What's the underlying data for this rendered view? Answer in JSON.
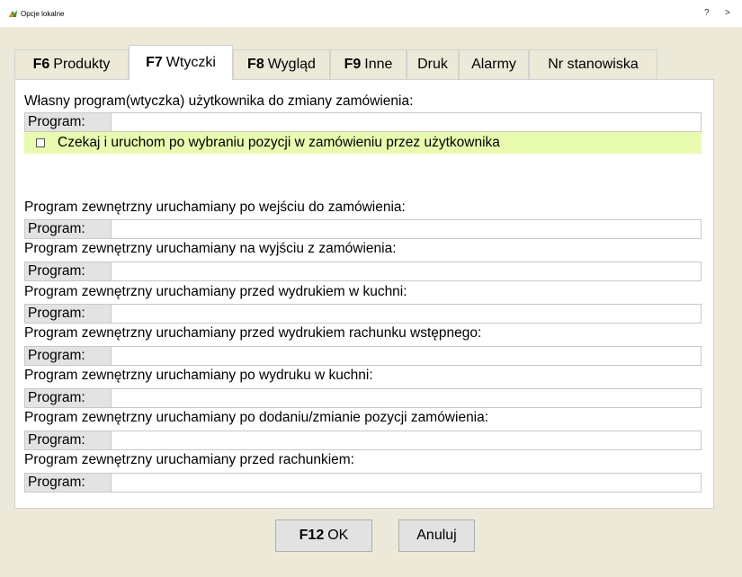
{
  "window": {
    "title": "Opcje lokalne",
    "help": "?",
    "close": ">"
  },
  "tabs": [
    {
      "key": "F6",
      "label": "Produkty"
    },
    {
      "key": "F7",
      "label": "Wtyczki"
    },
    {
      "key": "F8",
      "label": "Wygląd"
    },
    {
      "key": "F9",
      "label": "Inne"
    },
    {
      "key": "",
      "label": "Druk"
    },
    {
      "key": "",
      "label": "Alarmy"
    },
    {
      "key": "",
      "label": "Nr stanowiska"
    }
  ],
  "main": {
    "user_plugin_heading": "Własny program(wtyczka) użytkownika do zmiany zamówienia:",
    "program_label": "Program:",
    "wait_checkbox_label": "Czekaj i uruchom po wybraniu pozycji w zamówieniu przez użytkownika",
    "wait_checkbox_checked": false,
    "sections": [
      {
        "label": "Program zewnętrzny uruchamiany po wejściu do zamówienia:",
        "value": ""
      },
      {
        "label": "Program zewnętrzny uruchamiany na wyjściu z zamówienia:",
        "value": ""
      },
      {
        "label": "Program zewnętrzny uruchamiany przed wydrukiem w kuchni:",
        "value": ""
      },
      {
        "label": "Program zewnętrzny uruchamiany przed wydrukiem rachunku wstępnego:",
        "value": ""
      },
      {
        "label": "Program zewnętrzny uruchamiany po wydruku w kuchni:",
        "value": ""
      },
      {
        "label": "Program zewnętrzny uruchamiany po dodaniu/zmianie pozycji zamówienia:",
        "value": ""
      },
      {
        "label": "Program zewnętrzny uruchamiany przed rachunkiem:",
        "value": ""
      }
    ]
  },
  "buttons": {
    "ok_key": "F12",
    "ok_label": "OK",
    "cancel_label": "Anuluj"
  },
  "colors": {
    "dialog_bg": "#ece9d8",
    "checkbox_row_bg": "#e8fbae",
    "label_bg": "#e3e3e3"
  }
}
